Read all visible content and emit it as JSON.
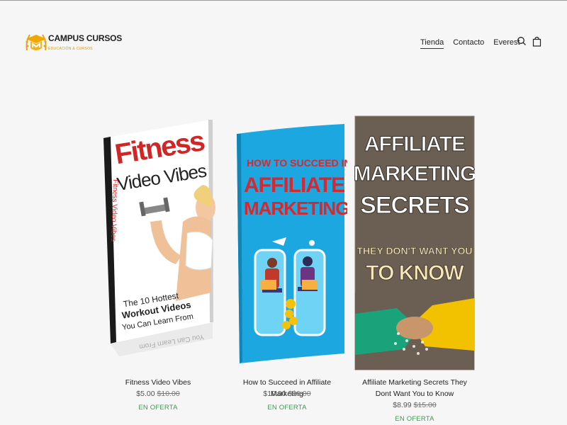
{
  "brand": {
    "name": "CAMPUS CURSOS",
    "tagline": "EDUCACIÓN & CURSOS",
    "accent": "#f0a800"
  },
  "nav": {
    "items": [
      "Tienda",
      "Contacto",
      "Everest"
    ],
    "active": "Tienda"
  },
  "header_icons": [
    "search-icon",
    "shopping-bag-icon"
  ],
  "products": [
    {
      "title": "Fitness Video Vibes",
      "price": "$5.00",
      "compare_price": "$10.00",
      "badge": "EN OFERTA",
      "cover": {
        "line1": "Fitness",
        "line2": "Video Vibes",
        "spine": "Fitness Video Vibes",
        "bottom1": "The 10 Hottest",
        "bottom2": "Workout Videos",
        "bottom3": "You Can Learn From",
        "reflection": "You Can Learn From"
      }
    },
    {
      "title": "How to Succeed in Affiliate Marketing",
      "price": "$10.00",
      "compare_price": "$20.00",
      "badge": "EN OFERTA",
      "cover": {
        "line1": "HOW TO SUCCEED IN",
        "line2": "AFFILIATE",
        "line3": "MARKETING"
      }
    },
    {
      "title": "Affiliate Marketing Secrets They Dont Want You to Know",
      "price": "$8.99",
      "compare_price": "$15.00",
      "badge": "EN OFERTA",
      "cover": {
        "line1": "AFFILIATE",
        "line2": "MARKETING",
        "line3": "SECRETS",
        "line4": "THEY DON'T WANT YOU",
        "line5": "TO KNOW"
      }
    }
  ]
}
